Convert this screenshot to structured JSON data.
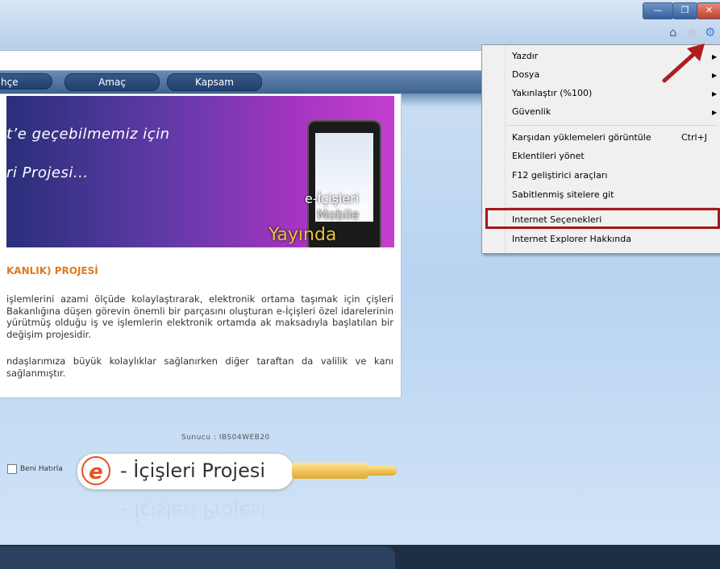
{
  "window": {
    "minimize_icon": "minimize-icon",
    "maximize_icon": "maximize-icon",
    "close_icon": "close-icon",
    "min_glyph": "—",
    "max_glyph": "❐",
    "close_glyph": "✕"
  },
  "toolbar": {
    "home_glyph": "⌂",
    "favorites_glyph": "☆",
    "tools_glyph": "⚙"
  },
  "nav": {
    "tabs": [
      "hçe",
      "Amaç",
      "Kapsam"
    ]
  },
  "banner": {
    "line1": "t’e geçebilmemiz için",
    "line2": "ri Projesi...",
    "logo_line1": "e-İçişleri",
    "logo_line2": "Mobile",
    "logo_line3": "Yayında"
  },
  "content": {
    "heading": "KANLIK) PROJESİ",
    "para1": "işlemlerini azami ölçüde kolaylaştırarak, elektronik ortama taşımak için çişleri Bakanlığına düşen görevin önemli bir parçasını oluşturan e-İçişleri özel idarelerinin yürütmüş olduğu iş ve işlemlerin elektronik ortamda ak maksadıyla başlatılan bir değişim projesidir.",
    "para2": "ndaşlarımıza büyük kolaylıklar sağlanırken diğer taraftan da valilik ve kanı sağlanmıştır."
  },
  "login": {
    "server_label": "Sunucu :  IBS04WEB20",
    "remember_me": "Beni Hatırla",
    "brand_e": "e",
    "brand_text": "- İçişleri Projesi"
  },
  "menu": {
    "items": [
      {
        "label": "Yazdır",
        "shortcut": "",
        "has_submenu": true
      },
      {
        "label": "Dosya",
        "shortcut": "",
        "has_submenu": true
      },
      {
        "label": "Yakınlaştır (%100)",
        "shortcut": "",
        "has_submenu": true
      },
      {
        "label": "Güvenlik",
        "shortcut": "",
        "has_submenu": true
      },
      {
        "label": "Karşıdan yüklemeleri görüntüle",
        "shortcut": "Ctrl+J",
        "has_submenu": false
      },
      {
        "label": "Eklentileri yönet",
        "shortcut": "",
        "has_submenu": false
      },
      {
        "label": "F12 geliştirici araçları",
        "shortcut": "",
        "has_submenu": false
      },
      {
        "label": "Sabitlenmiş sitelere git",
        "shortcut": "",
        "has_submenu": false
      },
      {
        "label": "Internet Seçenekleri",
        "shortcut": "",
        "has_submenu": false
      },
      {
        "label": "Internet Explorer Hakkında",
        "shortcut": "",
        "has_submenu": false
      }
    ],
    "submenu_glyph": "▶"
  },
  "annotation": {
    "highlight_color": "#a3171b",
    "arrow_color": "#b01c1f"
  }
}
